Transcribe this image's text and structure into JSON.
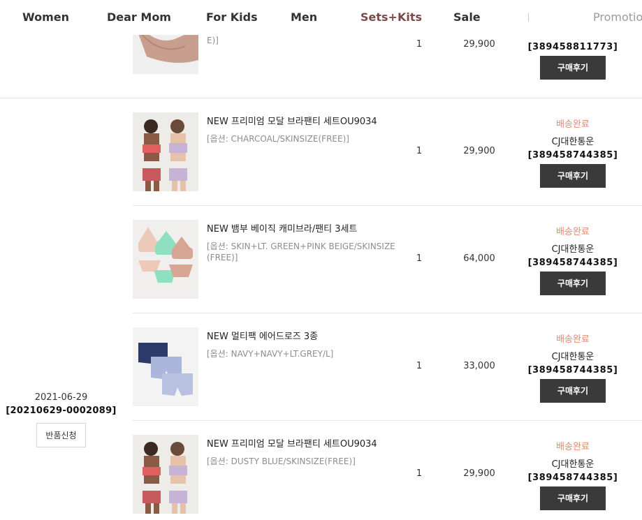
{
  "nav": {
    "items": [
      "Women",
      "Dear Mom",
      "For Kids",
      "Men",
      "Sets+Kits",
      "Sale",
      "Promotio"
    ]
  },
  "prev_row": {
    "option_tail": "E)]",
    "qty": "1",
    "price": "29,900",
    "tracking": "[389458811773]",
    "review_label": "구매후기"
  },
  "order": {
    "date": "2021-06-29",
    "number": "[20210629-0002089]",
    "return_label": "반품신청"
  },
  "items": [
    {
      "name": "NEW 프리미엄 모달 브라팬티 세트OU9034",
      "option": "[옵션: CHARCOAL/SKINSIZE(FREE)]",
      "qty": "1",
      "price": "29,900",
      "status": "배송완료",
      "carrier": "CJ대한통운",
      "tracking": "[389458744385]",
      "review_label": "구매후기"
    },
    {
      "name": "NEW 뱀부 베이직 캐미브라/팬티 3세트",
      "option": "[옵션: SKIN+LT. GREEN+PINK BEIGE/SKINSIZE(FREE)]",
      "qty": "1",
      "price": "64,000",
      "status": "배송완료",
      "carrier": "CJ대한통운",
      "tracking": "[389458744385]",
      "review_label": "구매후기"
    },
    {
      "name": "NEW 멀티팩 에어드로즈 3종",
      "option": "[옵션: NAVY+NAVY+LT.GREY/L]",
      "qty": "1",
      "price": "33,000",
      "status": "배송완료",
      "carrier": "CJ대한통운",
      "tracking": "[389458744385]",
      "review_label": "구매후기"
    },
    {
      "name": "NEW 프리미엄 모달 브라팬티 세트OU9034",
      "option": "[옵션: DUSTY BLUE/SKINSIZE(FREE)]",
      "qty": "1",
      "price": "29,900",
      "status": "배송완료",
      "carrier": "CJ대한통운",
      "tracking": "[389458744385]",
      "review_label": "구매후기"
    }
  ],
  "colors": {
    "accent_nav": "#7a4a4a",
    "status": "#e8866a",
    "button_dark": "#3a3a3a"
  }
}
